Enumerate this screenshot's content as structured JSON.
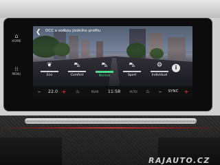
{
  "hardware": {
    "home": {
      "label": "HOME",
      "icon": "home-icon"
    },
    "menu": {
      "label": "MENU",
      "icon": "grid-icon"
    }
  },
  "screen": {
    "title": "DCC s volbou jízdního profilu",
    "back_icon": "back-arrow-icon",
    "info_icon": "info-icon",
    "modes": [
      {
        "label": "Eco",
        "icon": "eco-icon",
        "active": false
      },
      {
        "label": "Comfort",
        "icon": "car-comfort-icon",
        "active": false
      },
      {
        "label": "Normal",
        "icon": "car-normal-icon",
        "active": true
      },
      {
        "label": "Sport",
        "icon": "car-sport-icon",
        "active": false
      },
      {
        "label": "Individual",
        "icon": "individual-icon",
        "active": false
      }
    ],
    "accent_color": "#4fdc8a"
  },
  "climate": {
    "left_minus": "–",
    "left_temp": "22.0",
    "left_plus": "+",
    "seat_left_icon": "seat-heat-icon",
    "rear_defrost_label": "REAR",
    "time": "11:58",
    "recirc_label": "AUTO",
    "seat_right_icon": "seat-heat-icon",
    "right_minus": "–",
    "sync_label": "SYNC",
    "right_plus": "+",
    "plus_color": "#e52b2b"
  },
  "watermark": "RAJAUTO.CZ"
}
